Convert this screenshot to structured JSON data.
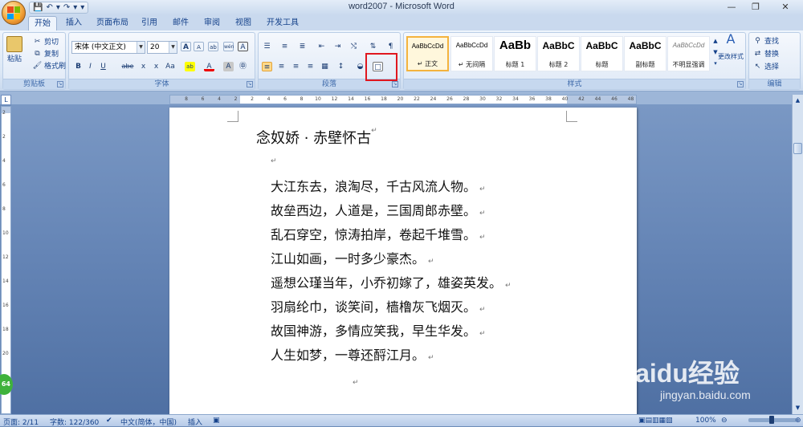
{
  "window": {
    "title": "word2007 - Microsoft Word",
    "minimize": "—",
    "restore": "❐",
    "close": "✕"
  },
  "qat": {
    "save": "💾",
    "undo": "↶",
    "undo_dd": "▾",
    "redo": "↷",
    "redo_dd": "▾",
    "customize": "▾"
  },
  "tabs": [
    {
      "label": "开始"
    },
    {
      "label": "插入"
    },
    {
      "label": "页面布局"
    },
    {
      "label": "引用"
    },
    {
      "label": "邮件"
    },
    {
      "label": "审阅"
    },
    {
      "label": "视图"
    },
    {
      "label": "开发工具"
    }
  ],
  "clipboard": {
    "paste": "粘贴",
    "cut": "剪切",
    "copy": "复制",
    "format_painter": "格式刷",
    "label": "剪贴板"
  },
  "font": {
    "name": "宋体 (中文正文)",
    "size": "20",
    "label": "字体",
    "grow": "A",
    "shrink": "A",
    "clear": "ab",
    "wen": "wén",
    "border_a": "A",
    "bold": "B",
    "italic": "I",
    "underline": "U",
    "strike": "abe",
    "sub": "x",
    "sup": "x",
    "case": "Aa",
    "highlight": "ab",
    "color": "A",
    "shade": "A",
    "circle": "㊥"
  },
  "paragraph": {
    "label": "段落"
  },
  "styles": {
    "label": "样式",
    "items": [
      {
        "sample": "AaBbCcDd",
        "name": "↵ 正文"
      },
      {
        "sample": "AaBbCcDd",
        "name": "↵ 无间隔"
      },
      {
        "sample": "AaBb",
        "name": "标题 1"
      },
      {
        "sample": "AaBbC",
        "name": "标题 2"
      },
      {
        "sample": "AaBbC",
        "name": "标题"
      },
      {
        "sample": "AaBbC",
        "name": "副标题"
      },
      {
        "sample": "AaBbCcDd",
        "name": "不明显强调"
      }
    ],
    "change_styles": "更改样式"
  },
  "editing": {
    "find": "查找",
    "replace": "替换",
    "select": "选择",
    "label": "编辑"
  },
  "ruler": {
    "h_ticks": [
      "8",
      "6",
      "4",
      "2",
      "2",
      "4",
      "6",
      "8",
      "10",
      "12",
      "14",
      "16",
      "18",
      "20",
      "22",
      "24",
      "26",
      "28",
      "30",
      "32",
      "34",
      "36",
      "38",
      "40",
      "42",
      "44",
      "46",
      "48"
    ],
    "v_ticks": [
      "2",
      "2",
      "4",
      "6",
      "8",
      "10",
      "12",
      "14",
      "16",
      "18",
      "20",
      "22"
    ],
    "corner": "L"
  },
  "document": {
    "title": "念奴娇 · 赤壁怀古",
    "para_mark": "↵",
    "lines": [
      "大江东去，浪淘尽，千古风流人物。",
      "故垒西边，人道是，三国周郎赤壁。",
      "乱石穿空，惊涛拍岸，卷起千堆雪。",
      "江山如画，一时多少豪杰。",
      "遥想公瑾当年，小乔初嫁了，雄姿英发。",
      "羽扇纶巾，谈笑间，樯橹灰飞烟灭。",
      "故国神游，多情应笑我，早生华发。",
      "人生如梦，一尊还酹江月。"
    ]
  },
  "status": {
    "page": "页面: 2/11",
    "words": "字数: 122/360",
    "language": "中文(简体，中国)",
    "insert": "插入",
    "zoom": "100%",
    "zoom_minus": "⊖",
    "zoom_plus": "⊕"
  },
  "overlay": {
    "badge": "64",
    "watermark_big": "Baidu经验",
    "watermark_small": "jingyan.baidu.com"
  },
  "colors": {
    "highlight_box": "#e0171f",
    "ribbon_bg": "#dbe7f5",
    "selected_style": "#f4b33d"
  }
}
